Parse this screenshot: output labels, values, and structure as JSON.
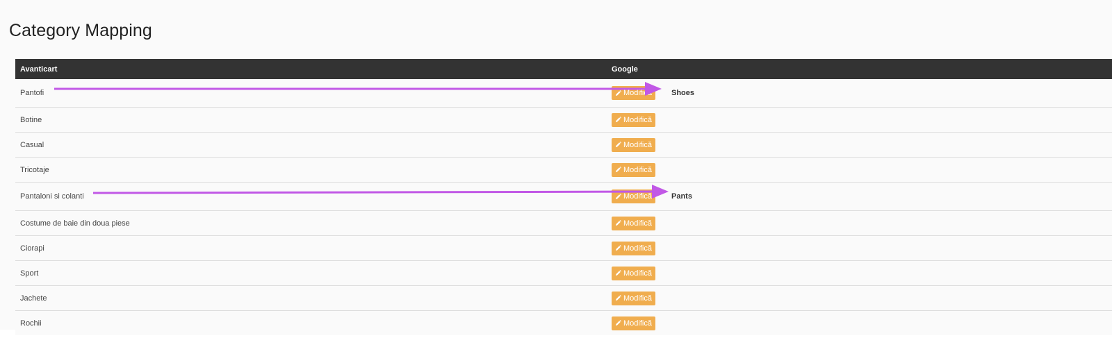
{
  "page": {
    "title": "Category Mapping"
  },
  "table": {
    "headers": {
      "avanticart": "Avanticart",
      "google": "Google"
    },
    "button_label": "Modifică",
    "rows": [
      {
        "name": "Pantofi",
        "google": "Shoes"
      },
      {
        "name": "Botine",
        "google": ""
      },
      {
        "name": "Casual",
        "google": ""
      },
      {
        "name": "Tricotaje",
        "google": ""
      },
      {
        "name": "Pantaloni si colanti",
        "google": "Pants"
      },
      {
        "name": "Costume de baie din doua piese",
        "google": ""
      },
      {
        "name": "Ciorapi",
        "google": ""
      },
      {
        "name": "Sport",
        "google": ""
      },
      {
        "name": "Jachete",
        "google": ""
      },
      {
        "name": "Rochii",
        "google": ""
      }
    ]
  },
  "colors": {
    "header_bg": "#333333",
    "button_bg": "#f0ad4e",
    "annotation_arrow": "#c158e6"
  },
  "icons": {
    "edit": "pencil-icon"
  }
}
